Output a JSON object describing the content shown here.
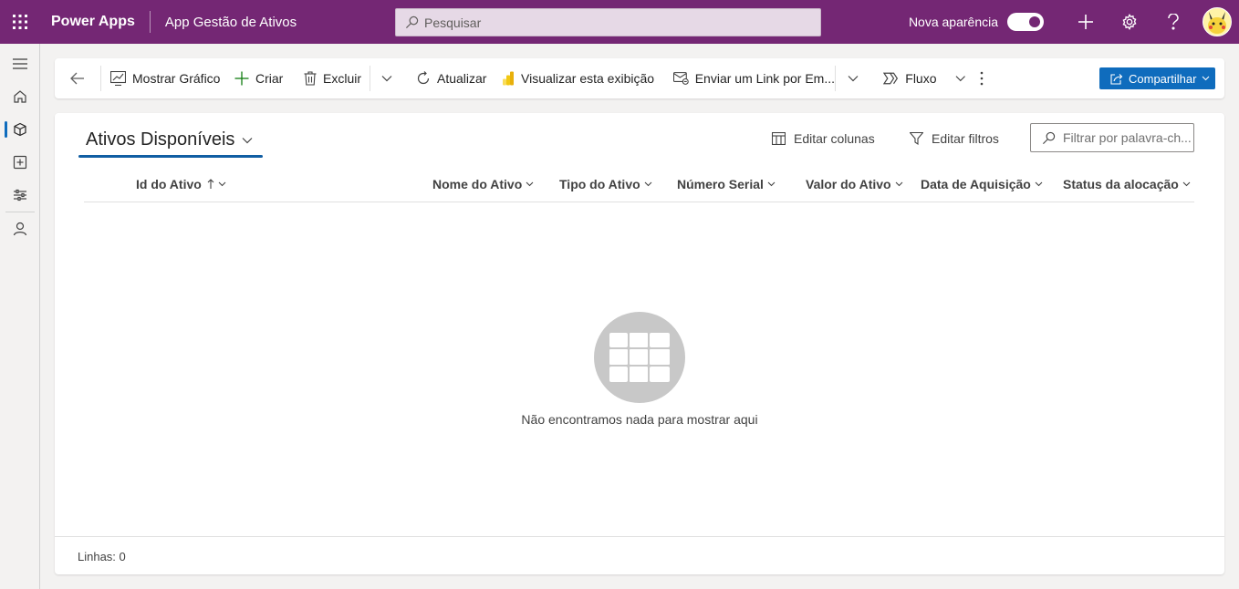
{
  "header": {
    "brand": "Power Apps",
    "app_name": "App Gestão de Ativos",
    "search_placeholder": "Pesquisar",
    "new_look_label": "Nova aparência",
    "colors": {
      "bar": "#742774"
    }
  },
  "rail": {
    "items": [
      "hamburger-icon",
      "home-icon",
      "cube-icon",
      "add-square-icon",
      "settings-sliders-icon",
      "person-icon"
    ]
  },
  "commands": {
    "back": "back-arrow-icon",
    "show_chart": "Mostrar Gráfico",
    "create": "Criar",
    "delete": "Excluir",
    "refresh": "Atualizar",
    "visualize": "Visualizar esta exibição",
    "email_link": "Enviar um Link por Em...",
    "flow": "Fluxo",
    "share": "Compartilhar"
  },
  "view": {
    "title": "Ativos Disponíveis",
    "edit_columns": "Editar colunas",
    "edit_filters": "Editar filtros",
    "keyword_filter_placeholder": "Filtrar por palavra-ch..."
  },
  "grid": {
    "columns": [
      {
        "label": "Id do Ativo",
        "sorted": "asc"
      },
      {
        "label": "Nome do Ativo"
      },
      {
        "label": "Tipo do Ativo"
      },
      {
        "label": "Número Serial"
      },
      {
        "label": "Valor do Ativo"
      },
      {
        "label": "Data de Aquisição"
      },
      {
        "label": "Status da alocação"
      }
    ],
    "rows": [],
    "empty_message": "Não encontramos nada para mostrar aqui",
    "footer": "Linhas: 0"
  }
}
